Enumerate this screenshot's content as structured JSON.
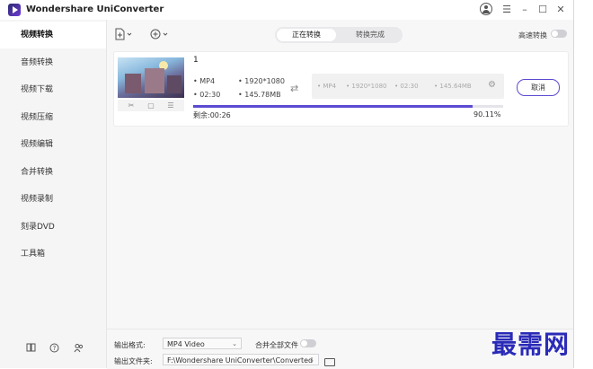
{
  "app": {
    "title": "Wondershare UniConverter"
  },
  "titlebar_icons": [
    "avatar-icon",
    "menu-icon",
    "minimize-icon",
    "maximize-icon",
    "close-icon"
  ],
  "sidebar": {
    "items": [
      {
        "label": "视频转换",
        "active": true
      },
      {
        "label": "音频转换"
      },
      {
        "label": "视频下载"
      },
      {
        "label": "视频压缩"
      },
      {
        "label": "视频编辑"
      },
      {
        "label": "合并转换"
      },
      {
        "label": "视频录制"
      },
      {
        "label": "刻录DVD"
      },
      {
        "label": "工具箱"
      }
    ],
    "bottom_icons": [
      "book-icon",
      "help-icon",
      "user-icon"
    ]
  },
  "tabs": {
    "converting": "正在转换",
    "finished": "转换完成",
    "active": "converting"
  },
  "high_speed": {
    "label": "高速转换",
    "on": false
  },
  "task": {
    "name": "1",
    "source": {
      "format": "MP4",
      "resolution": "1920*1080",
      "duration": "02:30",
      "size": "145.78MB"
    },
    "target": {
      "format": "MP4",
      "resolution": "1920*1080",
      "duration": "02:30",
      "size": "145.64MB"
    },
    "cancel_label": "取消",
    "remaining": "剩余:00:26",
    "progress_text": "90.11%",
    "progress": 0.9011
  },
  "bottom": {
    "output_format_label": "输出格式:",
    "output_format_value": "MP4 Video",
    "merge_label": "合并全部文件",
    "merge_on": false,
    "output_folder_label": "输出文件夹:",
    "output_folder_value": "F:\\Wondershare UniConverter\\Converted"
  },
  "watermark": "最需网",
  "colors": {
    "accent": "#5b4ad1",
    "watermark": "#2a2ab8"
  }
}
